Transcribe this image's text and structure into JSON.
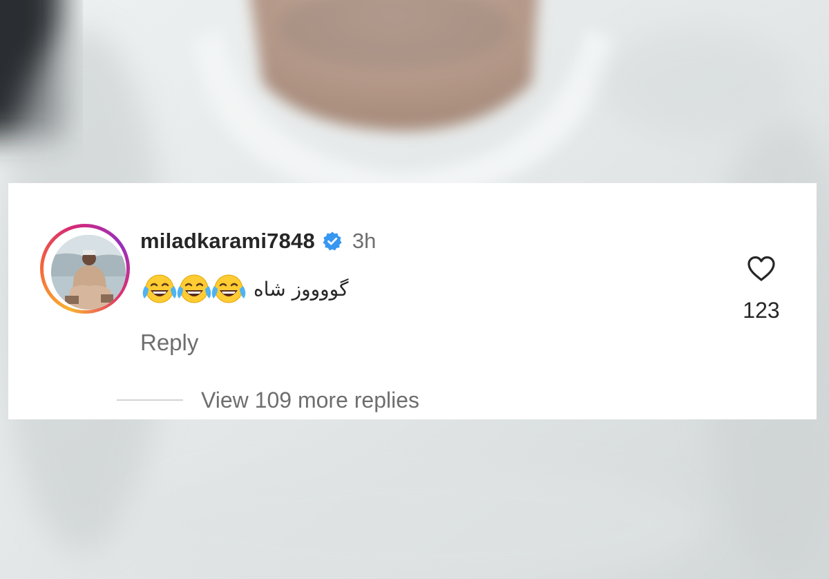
{
  "comment": {
    "username": "miladkarami7848",
    "verified": true,
    "timestamp": "3h",
    "text_persian": "گووووز شاه",
    "emoji_icon": "face-with-tears-of-joy-icon",
    "emoji_count": 3,
    "reply_label": "Reply",
    "like_count": "123",
    "view_more_replies_label": "View 109 more replies"
  },
  "colors": {
    "verified_badge": "#3897f0",
    "text_primary": "#262626",
    "text_secondary": "#6e6e6e",
    "card_background": "#ffffff"
  }
}
